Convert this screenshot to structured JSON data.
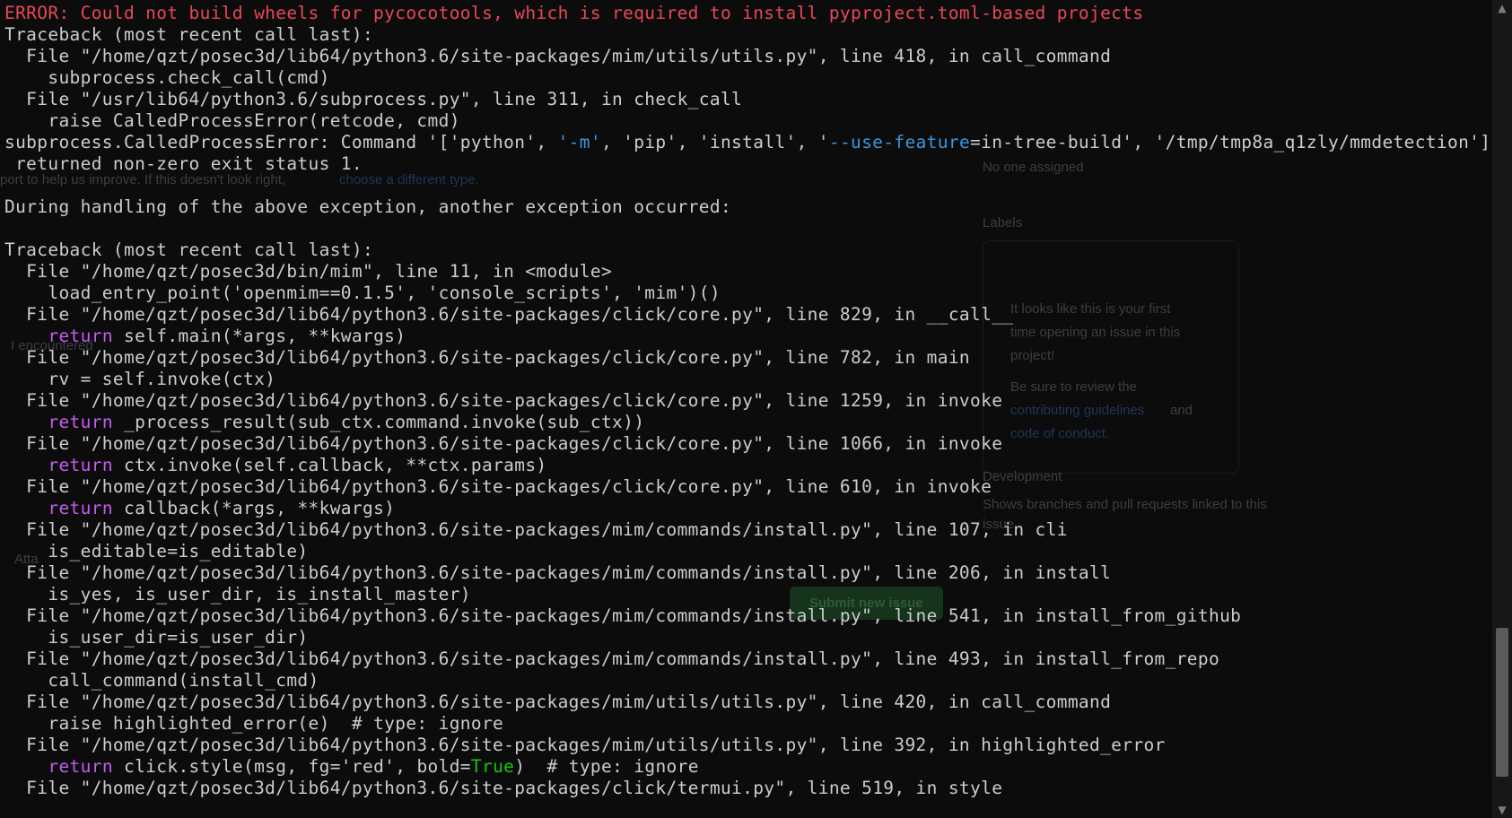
{
  "terminal": {
    "lines": [
      [
        {
          "t": "ERROR: Could not build wheels for pycocotools, which is required to install pyproject.toml-based projects",
          "c": "red"
        }
      ],
      [
        {
          "t": "Traceback (most recent call last):"
        }
      ],
      [
        {
          "t": "  File \"/home/qzt/posec3d/lib64/python3.6/site-packages/mim/utils/utils.py\", line 418, in call_command"
        }
      ],
      [
        {
          "t": "    subprocess.check_call(cmd)"
        }
      ],
      [
        {
          "t": "  File \"/usr/lib64/python3.6/subprocess.py\", line 311, in check_call"
        }
      ],
      [
        {
          "t": "    raise CalledProcessError(retcode, cmd)"
        }
      ],
      [
        {
          "t": "subprocess.CalledProcessError: Command '['python', "
        },
        {
          "t": "'-m'",
          "c": "blue"
        },
        {
          "t": ", 'pip', 'install', '"
        },
        {
          "t": "--use-feature",
          "c": "blue"
        },
        {
          "t": "=in-tree-build', '/tmp/tmp8a_q1zly/mmdetection']'"
        }
      ],
      [
        {
          "t": " returned non-zero exit status 1."
        }
      ],
      [
        {
          "t": ""
        }
      ],
      [
        {
          "t": "During handling of the above exception, another exception occurred:"
        }
      ],
      [
        {
          "t": ""
        }
      ],
      [
        {
          "t": "Traceback (most recent call last):"
        }
      ],
      [
        {
          "t": "  File \"/home/qzt/posec3d/bin/mim\", line 11, in <module>"
        }
      ],
      [
        {
          "t": "    load_entry_point('openmim==0.1.5', 'console_scripts', 'mim')()"
        }
      ],
      [
        {
          "t": "  File \"/home/qzt/posec3d/lib64/python3.6/site-packages/click/core.py\", line 829, in __call__"
        }
      ],
      [
        {
          "t": "    "
        },
        {
          "t": "return",
          "c": "kw"
        },
        {
          "t": " self.main(*args, **kwargs)"
        }
      ],
      [
        {
          "t": "  File \"/home/qzt/posec3d/lib64/python3.6/site-packages/click/core.py\", line 782, in main"
        }
      ],
      [
        {
          "t": "    rv = self.invoke(ctx)"
        }
      ],
      [
        {
          "t": "  File \"/home/qzt/posec3d/lib64/python3.6/site-packages/click/core.py\", line 1259, in invoke"
        }
      ],
      [
        {
          "t": "    "
        },
        {
          "t": "return",
          "c": "kw"
        },
        {
          "t": " _process_result(sub_ctx.command.invoke(sub_ctx))"
        }
      ],
      [
        {
          "t": "  File \"/home/qzt/posec3d/lib64/python3.6/site-packages/click/core.py\", line 1066, in invoke"
        }
      ],
      [
        {
          "t": "    "
        },
        {
          "t": "return",
          "c": "kw"
        },
        {
          "t": " ctx.invoke(self.callback, **ctx.params)"
        }
      ],
      [
        {
          "t": "  File \"/home/qzt/posec3d/lib64/python3.6/site-packages/click/core.py\", line 610, in invoke"
        }
      ],
      [
        {
          "t": "    "
        },
        {
          "t": "return",
          "c": "kw"
        },
        {
          "t": " callback(*args, **kwargs)"
        }
      ],
      [
        {
          "t": "  File \"/home/qzt/posec3d/lib64/python3.6/site-packages/mim/commands/install.py\", line 107, in cli"
        }
      ],
      [
        {
          "t": "    is_editable=is_editable)"
        }
      ],
      [
        {
          "t": "  File \"/home/qzt/posec3d/lib64/python3.6/site-packages/mim/commands/install.py\", line 206, in install"
        }
      ],
      [
        {
          "t": "    is_yes, is_user_dir, is_install_master)"
        }
      ],
      [
        {
          "t": "  File \"/home/qzt/posec3d/lib64/python3.6/site-packages/mim/commands/install.py\", line 541, in install_from_github"
        }
      ],
      [
        {
          "t": "    is_user_dir=is_user_dir)"
        }
      ],
      [
        {
          "t": "  File \"/home/qzt/posec3d/lib64/python3.6/site-packages/mim/commands/install.py\", line 493, in install_from_repo"
        }
      ],
      [
        {
          "t": "    call_command(install_cmd)"
        }
      ],
      [
        {
          "t": "  File \"/home/qzt/posec3d/lib64/python3.6/site-packages/mim/utils/utils.py\", line 420, in call_command"
        }
      ],
      [
        {
          "t": "    raise highlighted_error(e)  # type: ignore"
        }
      ],
      [
        {
          "t": "  File \"/home/qzt/posec3d/lib64/python3.6/site-packages/mim/utils/utils.py\", line 392, in highlighted_error"
        }
      ],
      [
        {
          "t": "    "
        },
        {
          "t": "return",
          "c": "kw"
        },
        {
          "t": " click.style(msg, fg='red', bold="
        },
        {
          "t": "True",
          "c": "green"
        },
        {
          "t": ")  # type: ignore"
        }
      ],
      [
        {
          "t": "  File \"/home/qzt/posec3d/lib64/python3.6/site-packages/click/termui.py\", line 519, in style"
        }
      ]
    ]
  },
  "background_page": {
    "no_one_assigned": "No one assigned",
    "labels": "Labels",
    "first_time_1": "It looks like this is your first",
    "first_time_2": "time opening an issue in this",
    "first_time_3": "project!",
    "review_1": "Be sure to review the",
    "contributing": "contributing guidelines",
    "and": "and",
    "code_of_conduct": "code of conduct.",
    "development": "Development",
    "dev_desc_1": "Shows branches and pull requests linked to this",
    "dev_desc_2": "issue.",
    "submit_label": "Submit new issue",
    "help_text": "port to help us improve. If this doesn't look right,",
    "choose_link": "choose a different type.",
    "encountered": "I encountered",
    "attach": "Atta"
  },
  "scrollbar": {
    "up_glyph": "▲",
    "down_glyph": "▼",
    "position": 0.96
  },
  "colors": {
    "background": "#0c0c0c",
    "foreground": "#cccccc",
    "error_red": "#e74856",
    "keyword_magenta": "#c55cf0",
    "option_blue": "#3a96dd",
    "bool_green": "#16c60c"
  }
}
